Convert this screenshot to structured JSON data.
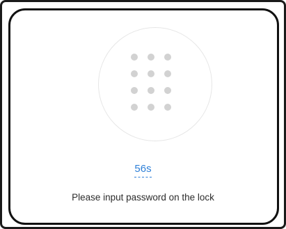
{
  "lock_screen": {
    "icon": "keypad-icon",
    "countdown": "56s",
    "message": "Please input password on the lock",
    "countdown_color": "#2f80d8"
  }
}
